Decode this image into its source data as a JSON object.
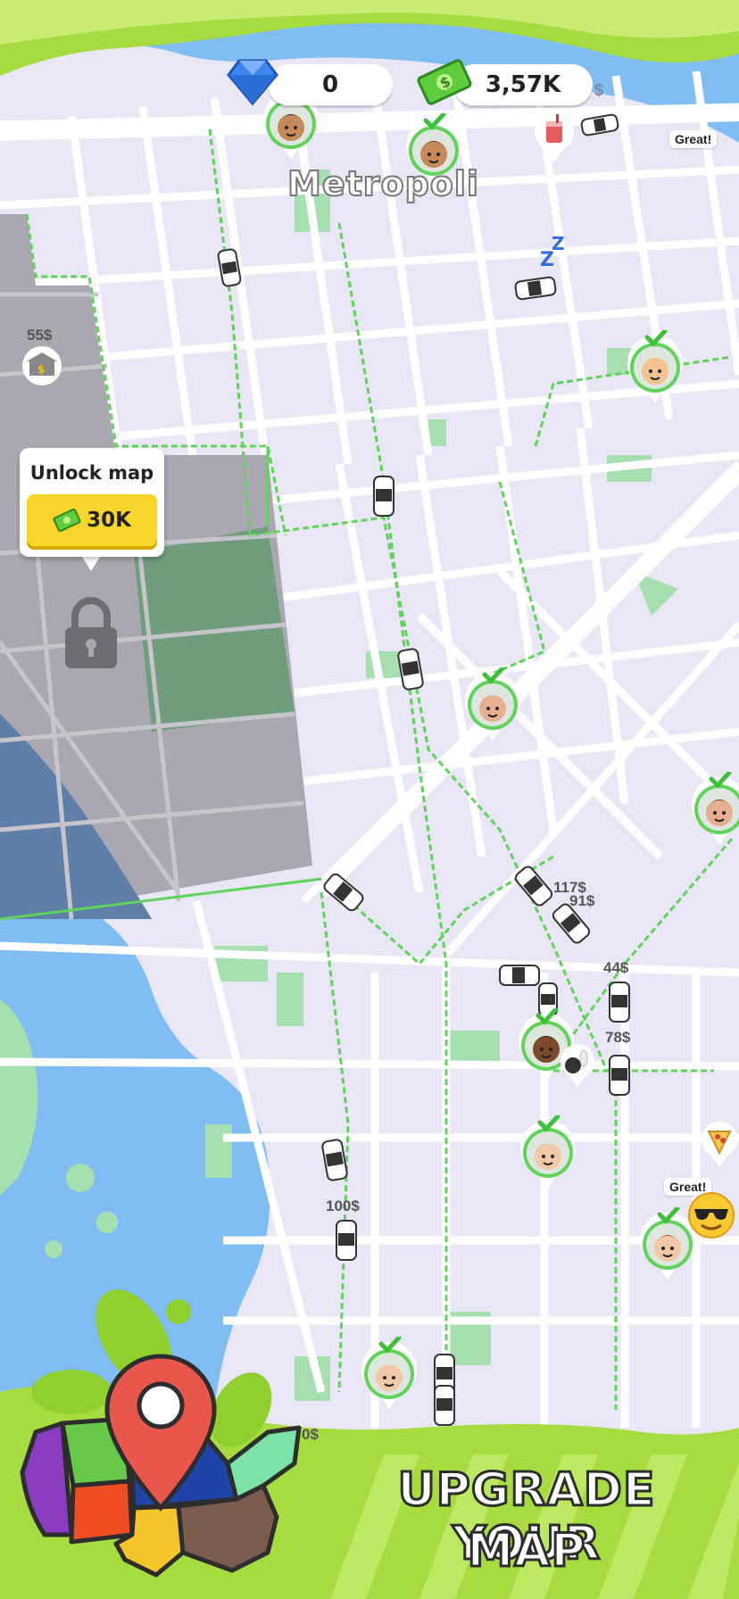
{
  "hud": {
    "gems": "0",
    "cash": "3,57K",
    "cash_cut": "$"
  },
  "map": {
    "city_name": "Metropoli"
  },
  "unlock": {
    "title": "Unlock map",
    "price": "30K"
  },
  "earnings": [
    {
      "text": "55$"
    },
    {
      "text": "117$"
    },
    {
      "text": "91$"
    },
    {
      "text": "44$"
    },
    {
      "text": "78$"
    },
    {
      "text": "100$"
    },
    {
      "text": "0$"
    }
  ],
  "reactions": [
    {
      "text": "Great!"
    },
    {
      "text": "Great!"
    }
  ],
  "banner": {
    "line1": "UPGRADE YOUR",
    "line2": "MAP"
  },
  "colors": {
    "map_bg": "#e9e7f5",
    "road": "#ffffff",
    "route": "#5fd35a",
    "water": "#7fbdf2",
    "park": "#a6e0b0",
    "locked": "#a9a8b0",
    "banner_green": "#a6dc3f",
    "gold": "#f8d52b"
  },
  "icons": [
    "diamond-icon",
    "cash-icon",
    "lock-icon",
    "location-pin-icon",
    "sleep-icon",
    "drink-icon",
    "pizza-icon",
    "bowling-icon",
    "sunglasses-emoji-icon",
    "checkmark-icon"
  ]
}
